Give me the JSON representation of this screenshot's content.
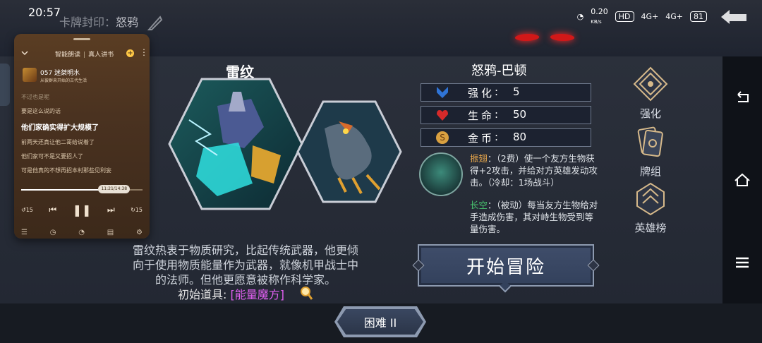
{
  "status_bar": {
    "time": "20:57",
    "speed": "0.20",
    "speed_unit": "KB/s",
    "hd": "HD",
    "net1": "4G+",
    "net2": "4G+",
    "battery": "81"
  },
  "game": {
    "seal_label": "卡牌封印：",
    "seal_name": "怒鸦",
    "card_name": "雷纹",
    "description": "雷纹热衷于物质研究，比起传统武器，他更倾向于使用物质能量作为武器，就像机甲战士中的法师。但他更愿意被称作科学家。",
    "item_prefix": "初始道具:",
    "item_name": "[能量魔方]",
    "character_name": "怒鸦-巴顿",
    "stats": [
      {
        "label": "强化",
        "value": "5",
        "icon": "upgrade-icon",
        "color": "#2f74d6"
      },
      {
        "label": "生命",
        "value": "50",
        "icon": "heart-icon",
        "color": "#d62a2a"
      },
      {
        "label": "金币",
        "value": "80",
        "icon": "coin-icon",
        "color": "#d9a040"
      }
    ],
    "skill1_name": "振翅",
    "skill1_text": "：（2费）使一个友方生物获得+2攻击，并给对方英雄发动攻击。（冷却：1场战斗）",
    "skill2_name": "长空",
    "skill2_text": "：（被动）每当友方生物给对手造成伤害，其对峙生物受到等量伤害。",
    "start_button": "开始冒险",
    "difficulty": "困难 II",
    "menu": [
      {
        "label": "强化",
        "icon": "enhance-emblem-icon"
      },
      {
        "label": "牌组",
        "icon": "deck-emblem-icon"
      },
      {
        "label": "英雄榜",
        "icon": "hero-ranking-emblem-icon"
      }
    ]
  },
  "player": {
    "tab1": "智能朗读",
    "tab2": "真人讲书",
    "episode_title": "057 迷桀明水",
    "episode_sub": "从彼群来开始的古代生活",
    "lyrics": [
      {
        "text": "不过也是呢",
        "style": "dim"
      },
      {
        "text": "要是这么说的话",
        "style": "normal"
      },
      {
        "text": "他们家确实得扩大规模了",
        "style": "current"
      },
      {
        "text": "前两天还真让他二哥给说着了",
        "style": "normal"
      },
      {
        "text": "他们家可不是又要招人了",
        "style": "normal"
      },
      {
        "text": "可是他真的不想再招本村那些见利妄",
        "style": "normal"
      }
    ],
    "progress_text": "11:21/14:38",
    "progress": 0.776,
    "controls": {
      "rewind": "15",
      "forward": "15"
    }
  },
  "colors": {
    "accent_magenta": "#e05ff0",
    "skill1_color": "#e7a64b",
    "skill2_color": "#48c46e"
  }
}
